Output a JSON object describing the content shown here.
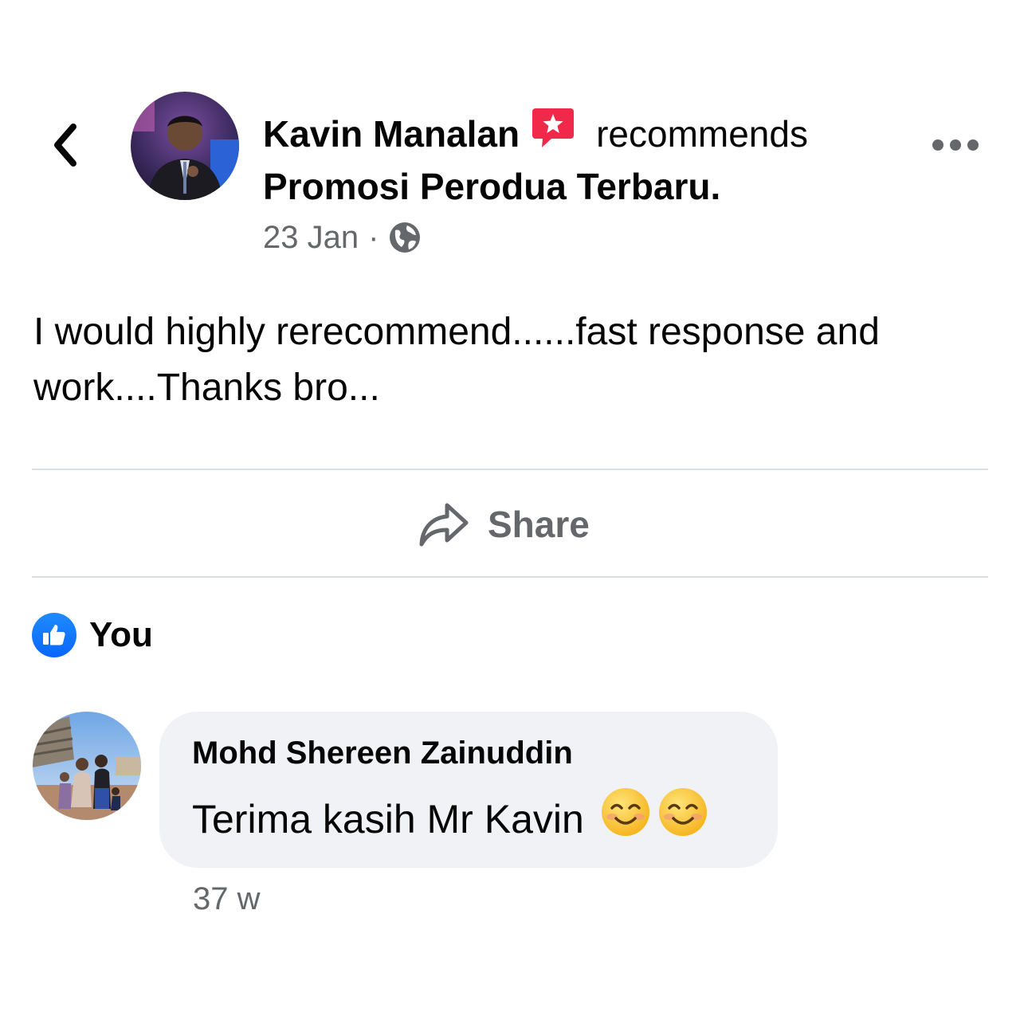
{
  "post": {
    "author_name": "Kavin Manalan",
    "recommends_word": "recommends",
    "page_name": "Promosi Perodua Terbaru",
    "page_name_suffix": ".",
    "date": "23 Jan",
    "meta_separator": "·",
    "privacy_icon": "globe-icon",
    "body": "I would highly rerecommend......fast response and work....Thanks bro..."
  },
  "actions": {
    "share_label": "Share",
    "share_icon": "share-arrow-icon"
  },
  "reactions": {
    "type": "like",
    "icon": "like-thumb-icon",
    "reactor": "You"
  },
  "comment": {
    "author": "Mohd Shereen Zainuddin",
    "text": "Terima kasih Mr Kavin",
    "emojis": [
      "smiling-face-icon",
      "smiling-face-icon"
    ],
    "time": "37 w"
  },
  "colors": {
    "like_blue": "#0866ff",
    "recommend_badge": "#f02849",
    "secondary_text": "#65676b",
    "bubble_bg": "#f0f2f5",
    "divider": "#dadde1"
  }
}
